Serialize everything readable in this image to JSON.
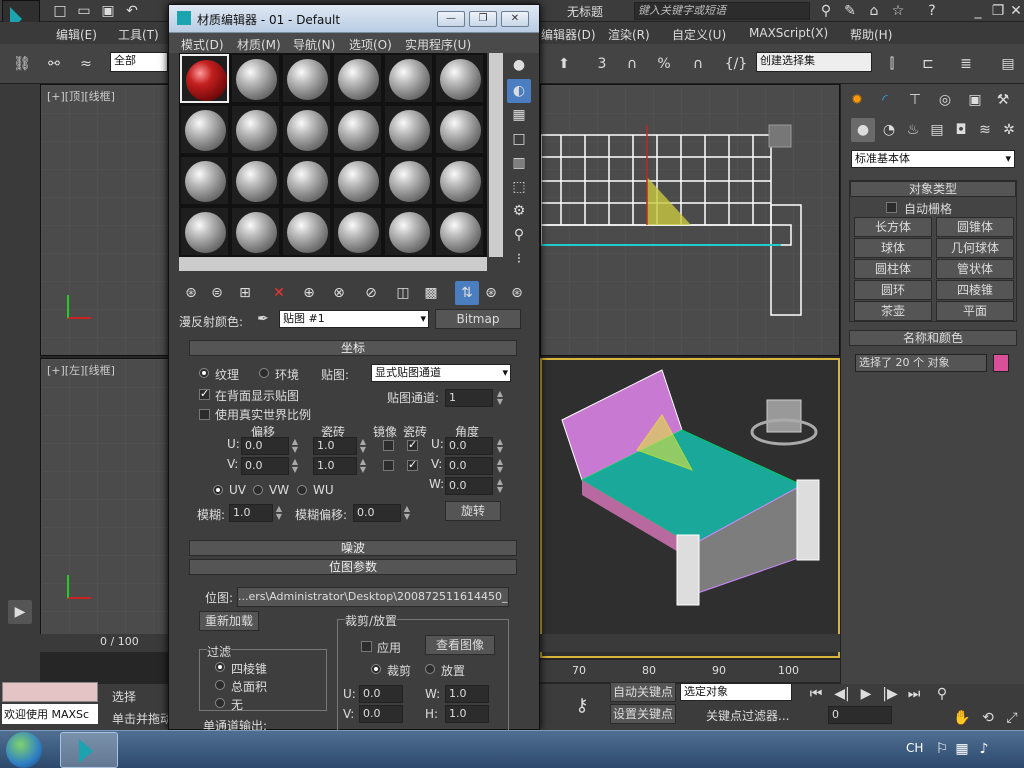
{
  "app": {
    "title": "无标题",
    "search_placeholder": "键入关键字或短语",
    "menu": [
      "编辑(E)",
      "工具(T)",
      "编辑器(D)",
      "渲染(R)",
      "自定义(U)",
      "MAXScript(X)",
      "帮助(H)"
    ],
    "selection_filter": "全部",
    "named_selection": "创建选择集",
    "ref_coord": "3"
  },
  "viewports": {
    "top_label": "[+][顶][线框]",
    "left_label": "[+][左][线框]",
    "timeline": "0 / 100",
    "ruler": [
      "70",
      "80",
      "90",
      "100"
    ]
  },
  "cmd": {
    "category": "标准基本体",
    "object_type_header": "对象类型",
    "autogrid": "自动栅格",
    "objects": [
      "长方体",
      "圆锥体",
      "球体",
      "几何球体",
      "圆柱体",
      "管状体",
      "圆环",
      "四棱锥",
      "茶壶",
      "平面"
    ],
    "name_color_header": "名称和颜色",
    "name_value": "选择了 20 个 对象",
    "name_color": "#d94f9a"
  },
  "dialog": {
    "title": "材质编辑器 - 01 - Default",
    "menu": [
      "模式(D)",
      "材质(M)",
      "导航(N)",
      "选项(O)",
      "实用程序(U)"
    ],
    "diffuse_label": "漫反射颜色:",
    "map_name": "贴图 #1",
    "map_type": "Bitmap",
    "coords": {
      "header": "坐标",
      "texture": "纹理",
      "environ": "环境",
      "mapping_label": "贴图:",
      "mapping_value": "显式贴图通道",
      "show_back": "在背面显示贴图",
      "channel_label": "贴图通道:",
      "channel_value": "1",
      "real_world": "使用真实世界比例",
      "offset": "偏移",
      "tiling": "瓷砖",
      "mirror": "镜像",
      "tile": "瓷砖",
      "angle": "角度",
      "u": "U:",
      "v": "V:",
      "w": "W:",
      "u_offset": "0.0",
      "v_offset": "0.0",
      "u_tiling": "1.0",
      "v_tiling": "1.0",
      "u_angle": "0.0",
      "v_angle": "0.0",
      "w_angle": "0.0",
      "uv": "UV",
      "vw": "VW",
      "wu": "WU",
      "blur_label": "模糊:",
      "blur": "1.0",
      "blur_off_label": "模糊偏移:",
      "blur_off": "0.0",
      "rotate": "旋转"
    },
    "noise_header": "噪波",
    "bitmap": {
      "header": "位图参数",
      "path_label": "位图:",
      "path": "...ers\\Administrator\\Desktop\\200872511614450_2.jpg",
      "reload": "重新加载",
      "crop_header": "裁剪/放置",
      "apply": "应用",
      "view_image": "查看图像",
      "crop": "裁剪",
      "place": "放置",
      "filter_header": "过滤",
      "filters": [
        "四棱锥",
        "总面积",
        "无"
      ],
      "u": "U:",
      "u_val": "0.0",
      "w": "W:",
      "w_val": "1.0",
      "v": "V:",
      "v_val": "0.0",
      "h": "H:",
      "h_val": "1.0",
      "mono_out": "单通道输出:"
    }
  },
  "status": {
    "welcome": "欢迎使用 MAXSc",
    "select": "选择",
    "click_drag": "单击并拖动",
    "auto_key": "自动关键点",
    "set_key": "设置关键点",
    "selected_obj": "选定对象",
    "key_filter": "关键点过滤器...",
    "frame": "0"
  },
  "taskbar": {
    "lang": "CH",
    "time": ""
  }
}
